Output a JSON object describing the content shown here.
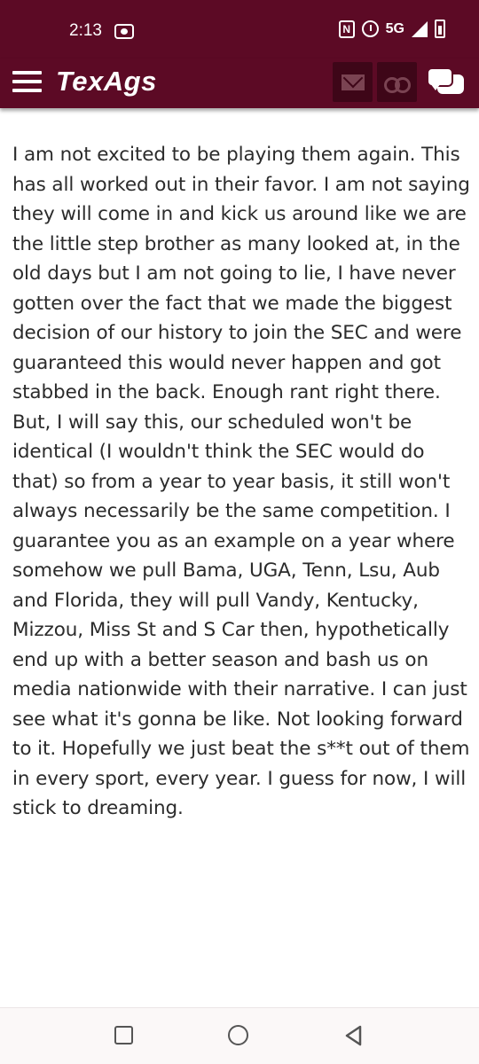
{
  "status_bar": {
    "time": "2:13",
    "network": "5G",
    "nfc_label": "N",
    "icons": [
      "cast-icon",
      "nfc-icon",
      "alarm-icon",
      "signal-icon",
      "battery-icon"
    ]
  },
  "header": {
    "logo": "TexAgs",
    "background_color": "#5c0a25",
    "icons": [
      "menu-icon",
      "mail-icon",
      "binoculars-icon",
      "chat-icon"
    ]
  },
  "post": {
    "body": "I am not excited to be playing them again. This has all worked out in their favor. I am not saying they will come in and kick us around like we are the little step brother as many looked at, in the old days but I am not going to lie, I have never gotten over the fact that we made the biggest decision of our history to join the SEC and were guaranteed this would never happen and got stabbed in the back. Enough rant right there. But, I will say this, our scheduled won't be identical (I wouldn't think the SEC would do that) so from a year to year basis, it still won't always necessarily be the same competition. I guarantee you as an example on a year where somehow we pull Bama, UGA, Tenn, Lsu, Aub and Florida, they will pull Vandy, Kentucky, Mizzou, Miss St and S Car then, hypothetically end up with a better season and bash us on media nationwide with their narrative. I can just see what it's gonna be like. Not looking forward to it. Hopefully we just beat the s**t out of them in every sport, every year. I guess for now, I will stick to dreaming."
  },
  "nav_bar": {
    "icons": [
      "recent-apps-icon",
      "home-icon",
      "back-icon"
    ]
  }
}
